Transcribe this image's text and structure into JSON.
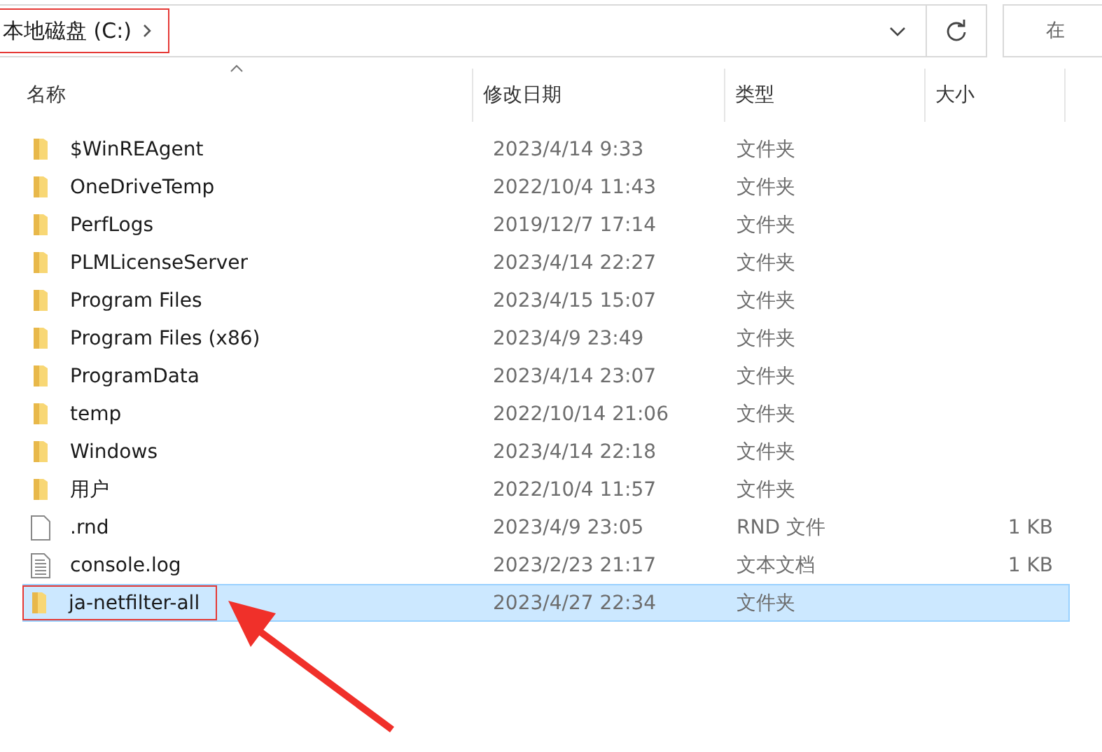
{
  "address_bar": {
    "path": "本地磁盘 (C:)",
    "highlighted": true
  },
  "search": {
    "placeholder": "在"
  },
  "columns": [
    {
      "label": "名称",
      "sorted": true
    },
    {
      "label": "修改日期",
      "sorted": false
    },
    {
      "label": "类型",
      "sorted": false
    },
    {
      "label": "大小",
      "sorted": false
    }
  ],
  "rows": [
    {
      "kind": "folder",
      "name": "$WinREAgent",
      "date": "2023/4/14 9:33",
      "type": "文件夹",
      "selected": false,
      "highlighted": false
    },
    {
      "kind": "folder",
      "name": "OneDriveTemp",
      "date": "2022/10/4 11:43",
      "type": "文件夹",
      "selected": false,
      "highlighted": false
    },
    {
      "kind": "folder",
      "name": "PerfLogs",
      "date": "2019/12/7 17:14",
      "type": "文件夹",
      "selected": false,
      "highlighted": false
    },
    {
      "kind": "folder",
      "name": "PLMLicenseServer",
      "date": "2023/4/14 22:27",
      "type": "文件夹",
      "selected": false,
      "highlighted": false
    },
    {
      "kind": "folder",
      "name": "Program Files",
      "date": "2023/4/15 15:07",
      "type": "文件夹",
      "selected": false,
      "highlighted": false
    },
    {
      "kind": "folder",
      "name": "Program Files (x86)",
      "date": "2023/4/9 23:49",
      "type": "文件夹",
      "selected": false,
      "highlighted": false
    },
    {
      "kind": "folder",
      "name": "ProgramData",
      "date": "2023/4/14 23:07",
      "type": "文件夹",
      "selected": false,
      "highlighted": false
    },
    {
      "kind": "folder",
      "name": "temp",
      "date": "2022/10/14 21:06",
      "type": "文件夹",
      "selected": false,
      "highlighted": false
    },
    {
      "kind": "folder",
      "name": "Windows",
      "date": "2023/4/14 22:18",
      "type": "文件夹",
      "selected": false,
      "highlighted": false
    },
    {
      "kind": "folder",
      "name": "用户",
      "date": "2022/10/4 11:57",
      "type": "文件夹",
      "selected": false,
      "highlighted": false
    },
    {
      "kind": "file",
      "name": ".rnd",
      "date": "2023/4/9 23:05",
      "type": "RND 文件",
      "size": "1 KB",
      "selected": false,
      "highlighted": false
    },
    {
      "kind": "text",
      "name": "console.log",
      "date": "2023/2/23 21:17",
      "type": "文本文档",
      "size": "1 KB",
      "selected": false,
      "highlighted": false
    },
    {
      "kind": "folder",
      "name": "ja-netfilter-all",
      "date": "2023/4/27 22:34",
      "type": "文件夹",
      "selected": true,
      "highlighted": true
    }
  ],
  "annotation_arrow": true
}
